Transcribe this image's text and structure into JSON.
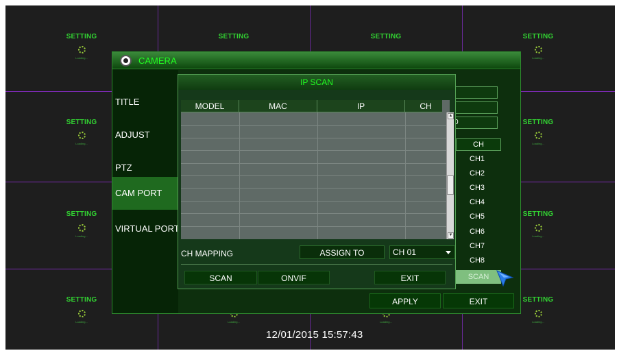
{
  "grid": {
    "cells": [
      {
        "setting": "SETTING",
        "loading": "Loading..."
      },
      {
        "setting": "SETTING",
        "loading": "Loading..."
      },
      {
        "setting": "SETTING",
        "loading": "Loading..."
      },
      {
        "setting": "SETTING",
        "loading": "Loading..."
      },
      {
        "setting": "SETTING",
        "loading": "Loading..."
      },
      {
        "setting": "SETTING",
        "loading": "Loading..."
      },
      {
        "setting": "SETTING",
        "loading": "Loading..."
      },
      {
        "setting": "SETTING",
        "loading": "Loading..."
      },
      {
        "setting": "SETTING",
        "loading": "Loading..."
      },
      {
        "setting": "SETTING",
        "loading": "Loading..."
      },
      {
        "setting": "SETTING",
        "loading": "Loading..."
      },
      {
        "setting": "SETTING",
        "loading": "Loading..."
      }
    ],
    "datetime": "12/01/2015 15:57:43"
  },
  "camera_window": {
    "title": "CAMERA",
    "icon": "camera-icon",
    "side_items": [
      {
        "label": "TITLE"
      },
      {
        "label": "ADJUST"
      },
      {
        "label": "PTZ"
      },
      {
        "label": "CAM PORT",
        "active": true
      },
      {
        "label": "VIRTUAL PORT"
      }
    ],
    "right_fields": [
      "",
      "",
      "0"
    ],
    "ch_header": "CH",
    "ch_list": [
      "CH1",
      "CH2",
      "CH3",
      "CH4",
      "CH5",
      "CH6",
      "CH7",
      "CH8"
    ],
    "scan_label": "SCAN",
    "apply_label": "APPLY",
    "exit_label": "EXIT"
  },
  "ip_scan": {
    "title": "IP SCAN",
    "columns": [
      "MODEL",
      "MAC",
      "IP",
      "CH"
    ],
    "ch_mapping_label": "CH MAPPING",
    "assign_label": "ASSIGN TO",
    "ch_selected": "CH 01",
    "buttons": {
      "scan": "SCAN",
      "onvif": "ONVIF",
      "exit": "EXIT"
    }
  },
  "colors": {
    "accent_green": "#22ff22",
    "setting_green": "#32d232",
    "divider_purple": "#7a2ab0",
    "cursor_blue": "#2a7de8"
  }
}
